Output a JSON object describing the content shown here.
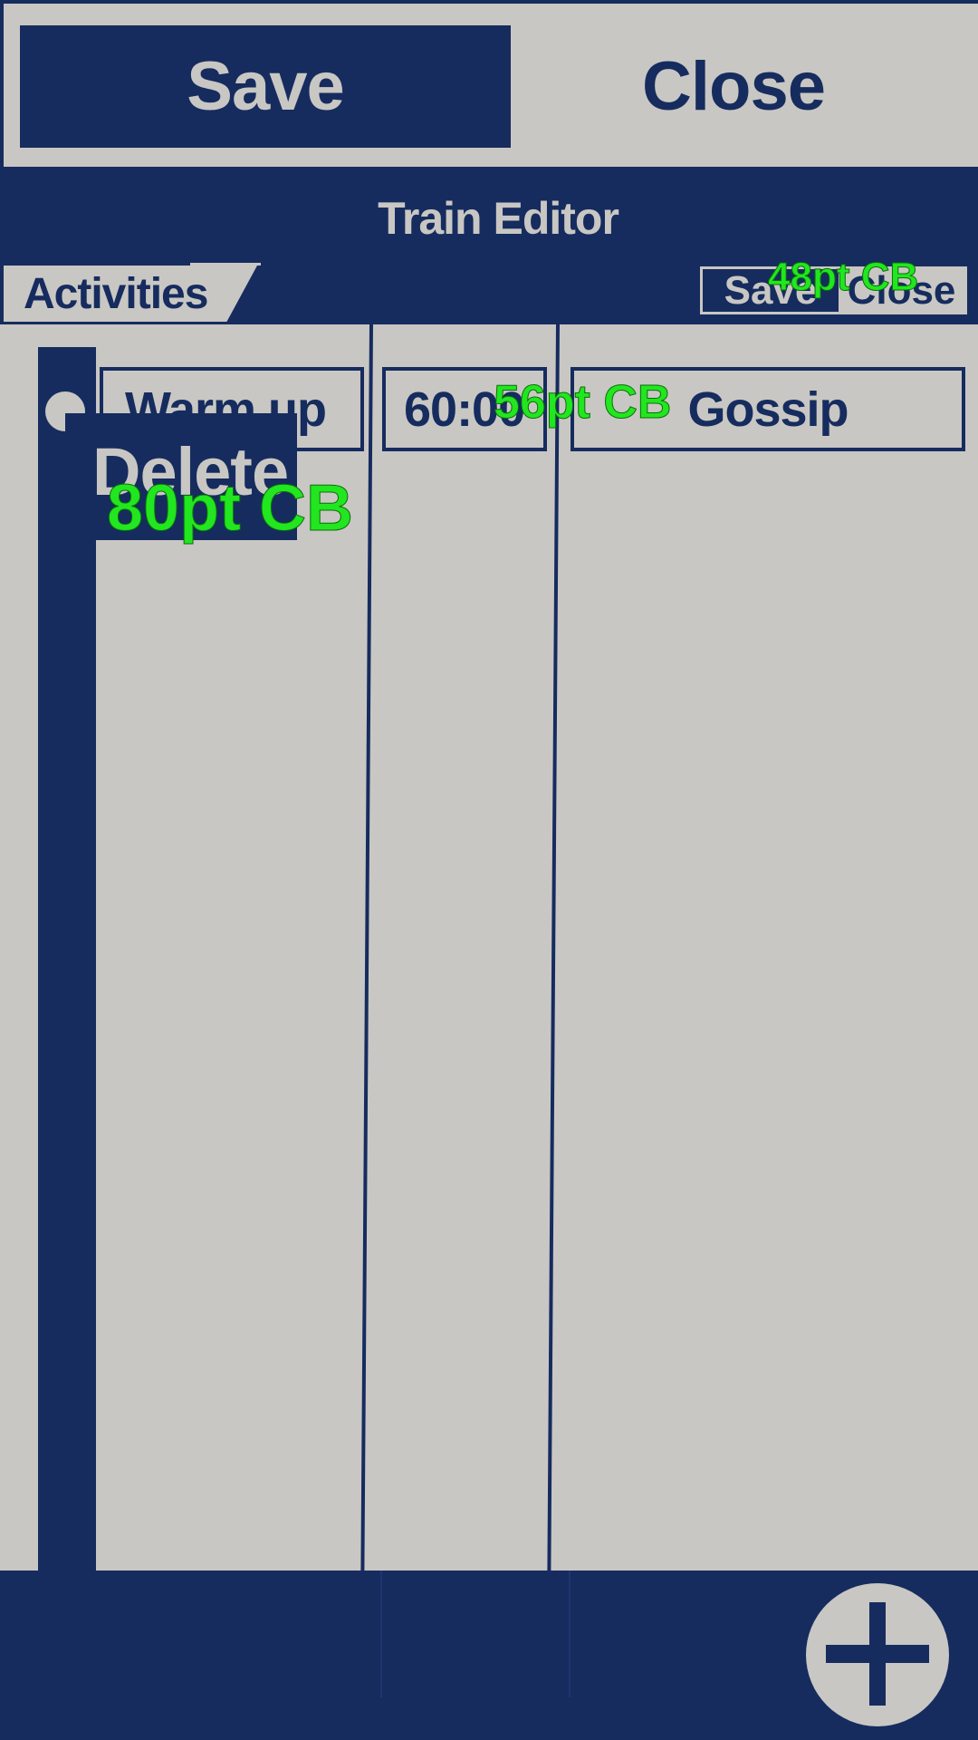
{
  "toolbar": {
    "save_label": "Save",
    "close_label": "Close"
  },
  "header": {
    "title": "Train Editor",
    "tab_label": "Activities",
    "mini_save_label": "Save",
    "mini_close_label": "Close",
    "size_annotation": "48pt CB"
  },
  "activity_row": {
    "name": "Warm up",
    "duration": "60:00",
    "category": "Gossip",
    "duration_annotation": "56pt CB",
    "delete_label": "Delete",
    "delete_annotation": "80pt CB"
  },
  "footer": {
    "add_icon": "plus-icon"
  },
  "colors": {
    "navy": "#162c5f",
    "background": "#c9c7c3",
    "annotation": "#22e61f"
  }
}
